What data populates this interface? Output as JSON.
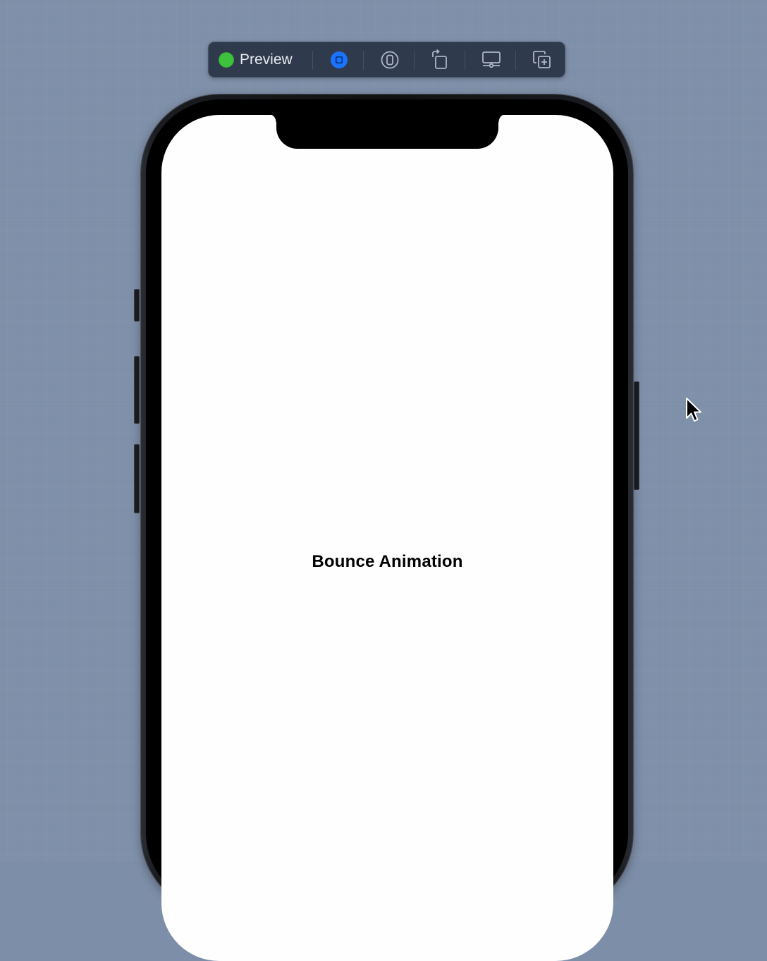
{
  "toolbar": {
    "status_color": "#3ec23e",
    "preview_label": "Preview",
    "buttons": [
      {
        "id": "live",
        "icon": "live-preview-icon",
        "active": true,
        "color": "#1a73ff"
      },
      {
        "id": "device",
        "icon": "device-icon"
      },
      {
        "id": "rotate",
        "icon": "rotate-device-icon"
      },
      {
        "id": "settings",
        "icon": "device-settings-icon"
      },
      {
        "id": "duplicate",
        "icon": "duplicate-preview-icon"
      }
    ]
  },
  "device": {
    "screen_background": "#fefefe",
    "frame_color": "#000000"
  },
  "screen": {
    "title": "Bounce Animation"
  },
  "canvas": {
    "background": "#7d8ea8"
  }
}
